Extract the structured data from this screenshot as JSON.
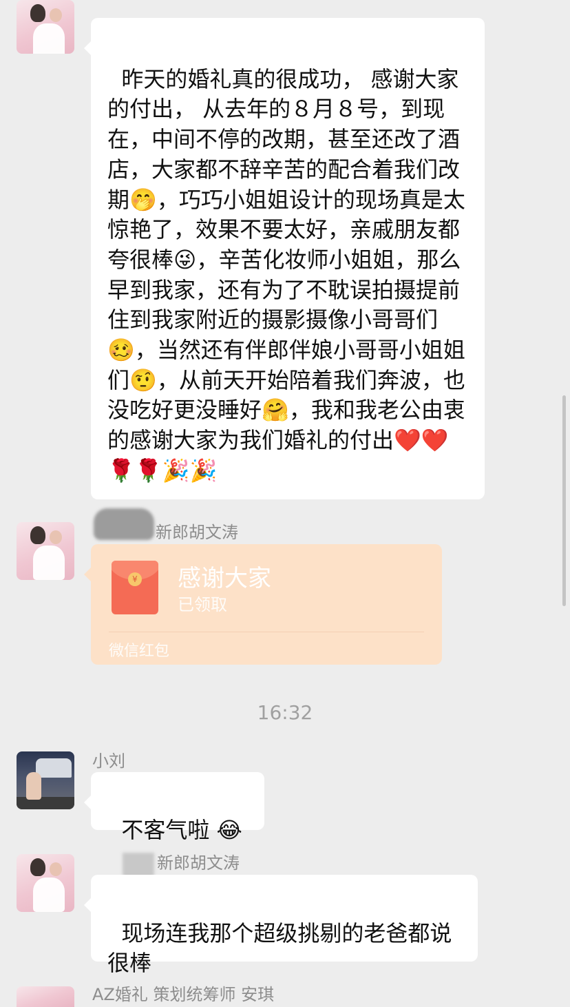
{
  "messages": {
    "m1": {
      "text": "昨天的婚礼真的很成功， 感谢大家的付出， 从去年的８月８号，到现在，中间不停的改期，甚至还改了酒店，大家都不辞辛苦的配合着我们改期🤭，巧巧小姐姐设计的现场真是太惊艳了，效果不要太好，亲戚朋友都夸很棒😜，辛苦化妆师小姐姐，那么早到我家，还有为了不耽误拍摄提前住到我家附近的摄影摄像小哥哥们🥴，当然还有伴郎伴娘小哥哥小姐姐们🤨，从前天开始陪着我们奔波，也没吃好更没睡好🤗，我和我老公由衷的感谢大家为我们婚礼的付出❤️❤️🌹🌹🎉🎉"
    },
    "m2": {
      "sender": "新郎胡文涛",
      "red_packet": {
        "title": "感谢大家",
        "status": "已领取",
        "label": "微信红包"
      }
    },
    "timestamp": "16:32",
    "m3": {
      "sender": "小刘",
      "text": "不客气啦 😂"
    },
    "m4": {
      "sender": "新郎胡文涛",
      "text": "现场连我那个超级挑剔的老爸都说很棒"
    },
    "m5": {
      "sender": "AZ婚礼 策划统筹师  安琪"
    }
  },
  "colors": {
    "background": "#ededed",
    "bubble": "#ffffff",
    "red_packet_bg": "#fde1c8",
    "red_packet_icon": "#f46b55"
  }
}
